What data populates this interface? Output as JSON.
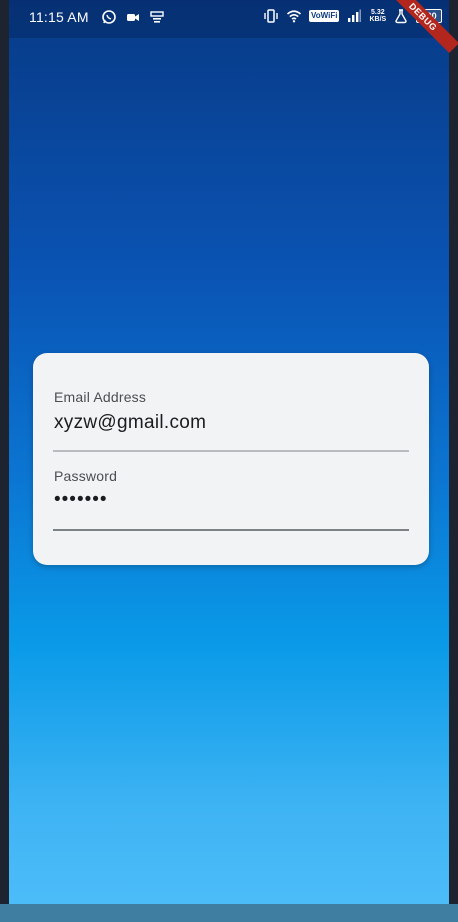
{
  "status_bar": {
    "time": "11:15 AM",
    "left_icons": [
      "whatsapp-icon",
      "video-camera-icon",
      "cast-icon"
    ],
    "right_icons": [
      "vibrate-icon",
      "wifi-icon",
      "vowifi-badge",
      "signal-icon",
      "network-speed",
      "flask-icon",
      "battery-icon"
    ],
    "vowifi_label": "VoWiFi",
    "network_speed_top": "5.32",
    "network_speed_bottom": "KB/S",
    "battery_level": "100"
  },
  "debug_banner": "DEBUG",
  "login_form": {
    "email": {
      "label": "Email Address",
      "value": "xyzw@gmail.com"
    },
    "password": {
      "label": "Password",
      "value": "•••••••"
    }
  },
  "colors": {
    "gradient_top": "#083a86",
    "gradient_bottom": "#4ebef9",
    "card_background": "#f2f3f5",
    "debug_ribbon": "#b3261e"
  }
}
